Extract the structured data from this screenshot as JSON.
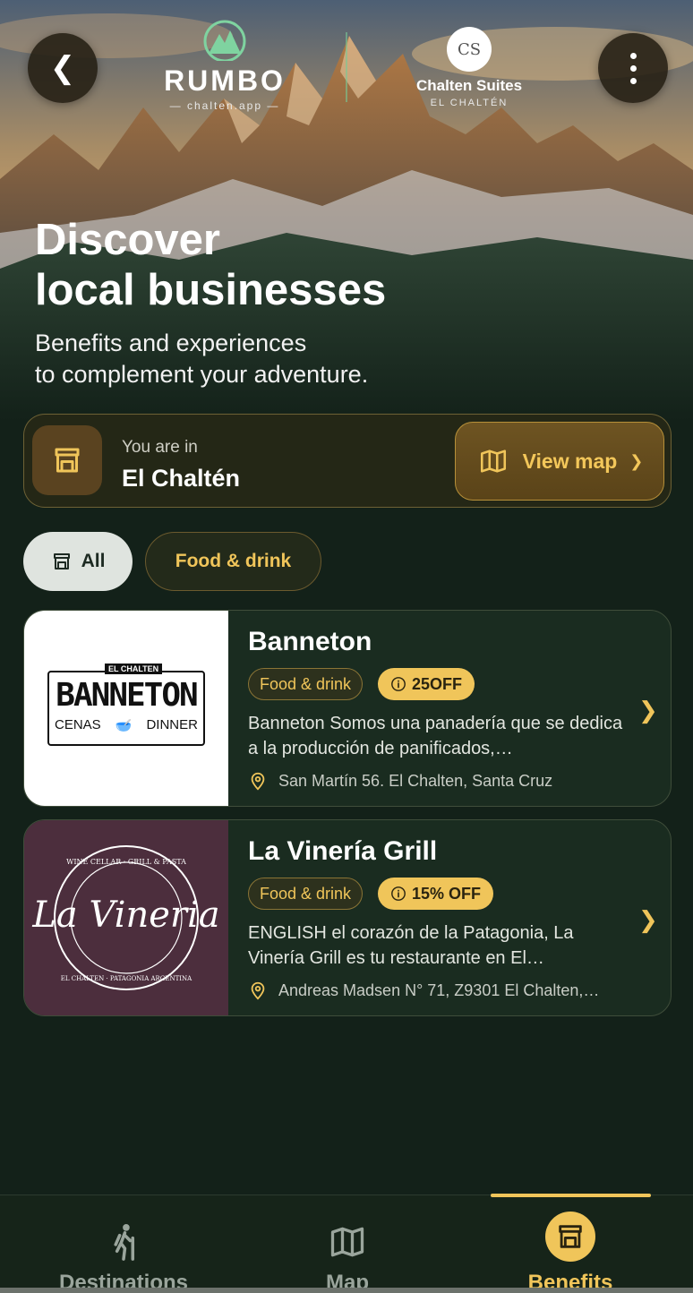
{
  "header": {
    "brand_name": "RUMBO",
    "brand_sub": "— chalten.app —",
    "partner_name": "Chalten Suites",
    "partner_sub": "EL CHALTÉN",
    "partner_logo_initials": "CS"
  },
  "hero": {
    "title_line1": "Discover",
    "title_line2": "local businesses",
    "subtitle_line1": "Benefits and experiences",
    "subtitle_line2": "to complement your adventure."
  },
  "location": {
    "label": "You are in",
    "value": "El Chaltén",
    "map_button": "View map"
  },
  "filters": [
    {
      "label": "All",
      "selected": true
    },
    {
      "label": "Food & drink",
      "selected": false
    }
  ],
  "businesses": [
    {
      "name": "Banneton",
      "category": "Food & drink",
      "discount": "25OFF",
      "description": "Banneton Somos una panadería que se dedica a la producción de panificados,…",
      "address": "San Martín 56. El Chalten, Santa Cruz",
      "logo": {
        "top": "EL CHALTEN",
        "main": "BANNETON",
        "left": "CENAS",
        "right": "DINNER"
      }
    },
    {
      "name": "La Vinería Grill",
      "category": "Food & drink",
      "discount": "15% OFF",
      "description": "ENGLISH el corazón de la Patagonia, La Vinería Grill es tu restaurante en El…",
      "address": "Andreas Madsen N° 71, Z9301 El Chalten,…",
      "logo": {
        "main": "La Vineria",
        "ring_top": "WINE CELLAR · GRILL & PASTA",
        "ring_bottom": "EL CHALTEN · PATAGONIA ARGENTINA"
      }
    }
  ],
  "nav": [
    {
      "label": "Destinations",
      "icon": "hiker-icon",
      "active": false
    },
    {
      "label": "Map",
      "icon": "map-icon",
      "active": false
    },
    {
      "label": "Benefits",
      "icon": "store-icon",
      "active": true
    }
  ],
  "colors": {
    "accent": "#f0c55a",
    "background": "#132119",
    "card": "#1a2c20"
  }
}
